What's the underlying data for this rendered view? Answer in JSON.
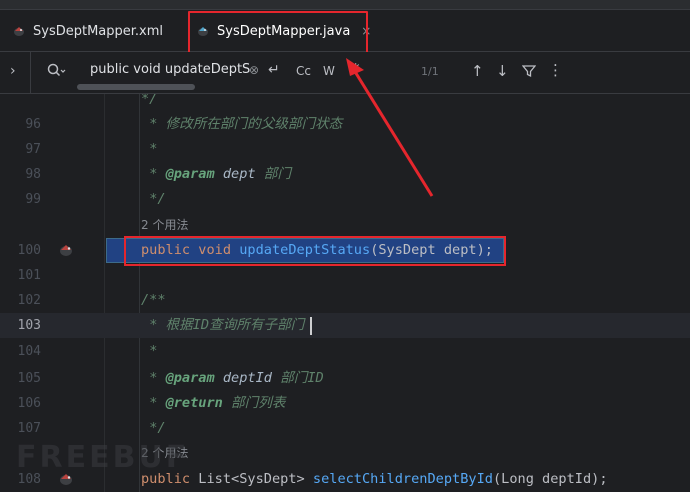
{
  "tabs": [
    {
      "label": "SysDeptMapper.xml"
    },
    {
      "label": "SysDeptMapper.java",
      "close": "×"
    }
  ],
  "search": {
    "chevron": "›",
    "query": "public void updateDeptS",
    "clear": "⊗",
    "newline": "↵",
    "match_case": "Cc",
    "words": "W",
    "regex": "*",
    "count": "1/1",
    "prev": "↑",
    "next": "↓",
    "more": "⋮"
  },
  "code": {
    "line_numbers": [
      "96",
      "97",
      "98",
      "99",
      "100",
      "101",
      "102",
      "103",
      "104",
      "105",
      "106",
      "107",
      "108"
    ],
    "top_partial": "*/",
    "l96": "* 修改所在部门的父级部门状态",
    "star": "*",
    "param_tag": "@param",
    "l98_name": "dept",
    "l98_desc": "部门",
    "close_comment": "*/",
    "usage_hint": "2 个用法",
    "l100_public": "public",
    "l100_void": "void",
    "l100_method": "updateDeptStatus",
    "l100_args": "(SysDept dept);",
    "open_doc": "/**",
    "l103": "* 根据ID查询所有子部门",
    "l105_name": "deptId",
    "l105_desc": "部门ID",
    "return_tag": "@return",
    "l106_desc": "部门列表",
    "usage_hint2": "2 个用法",
    "l108_public": "public",
    "l108_type": "List<SysDept>",
    "l108_method": "selectChildrenDeptById",
    "l108_args": "(Long deptId);"
  },
  "watermark": "FREEBUF",
  "colors": {
    "background": "#1e1f22",
    "accent": "#3574f0",
    "annotation_red": "#e5262d",
    "keyword": "#cf8e6d",
    "method": "#56a8f5",
    "comment": "#5f826b"
  }
}
